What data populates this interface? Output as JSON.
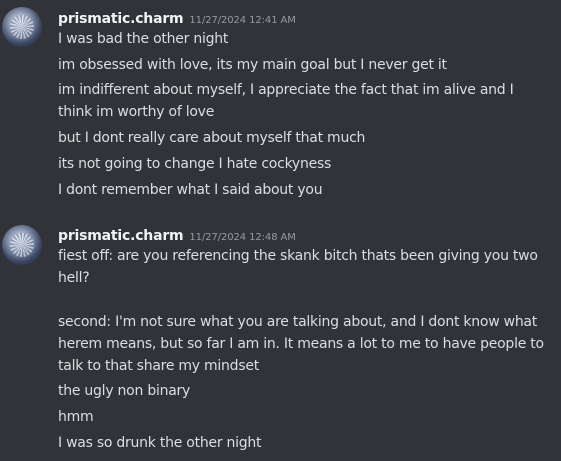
{
  "messages": [
    {
      "username": "prismatic.charm",
      "timestamp": "11/27/2024 12:41 AM",
      "avatar_icon": "disco-ball-avatar",
      "lines": [
        "I was bad the other night",
        "im obsessed with love, its my main goal but I never get it",
        "im indifferent about myself, I appreciate the fact that im alive and I",
        "think im worthy of love",
        "but I dont really care about myself that much",
        "its not going to change  I hate cockyness",
        "I dont remember what I said about you"
      ]
    },
    {
      "username": "prismatic.charm",
      "timestamp": "11/27/2024 12:48 AM",
      "avatar_icon": "disco-ball-avatar",
      "lines": [
        "fiest off: are you referencing the skank bitch thats been giving you two",
        "hell?",
        "second: I'm not sure what you are talking about, and I dont know what",
        "herem means, but so far I am in. It means a lot to me to have people to",
        "talk to that share my mindset",
        "the ugly non binary",
        "hmm",
        "I was so drunk the other night"
      ]
    }
  ],
  "colors": {
    "background": "#323339",
    "username": "#f2f3f5",
    "timestamp": "#949ba4",
    "message_text": "#dbdee1"
  }
}
